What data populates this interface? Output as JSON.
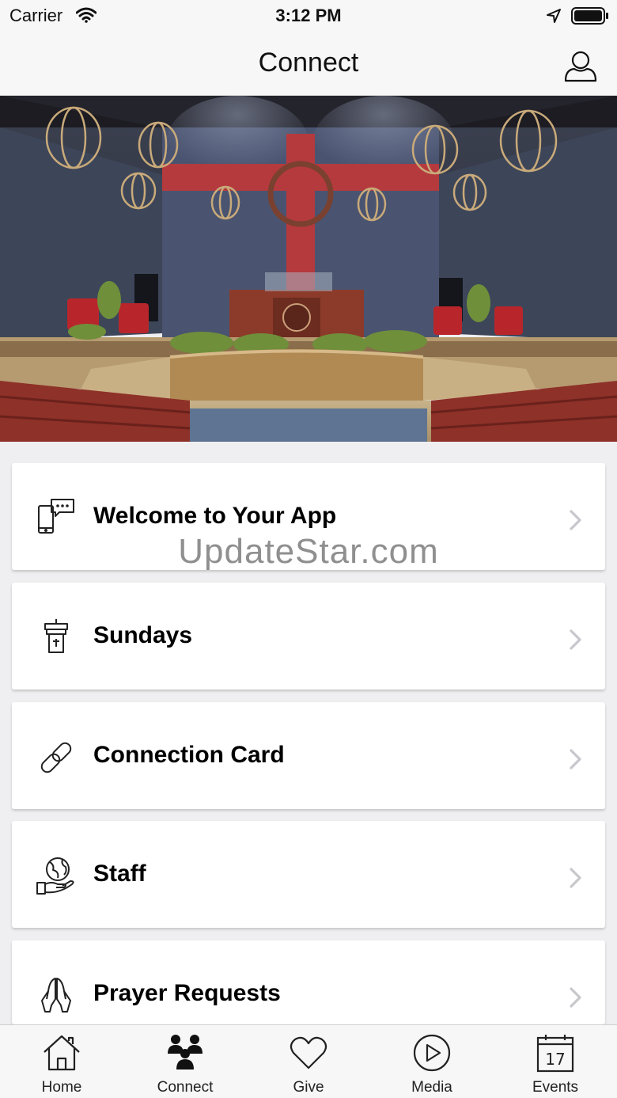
{
  "status_bar": {
    "carrier": "Carrier",
    "time": "3:12 PM"
  },
  "nav": {
    "title": "Connect",
    "profile_icon": "person-icon"
  },
  "hero": {
    "description_icon": "sanctuary-photo"
  },
  "menu": [
    {
      "label": "Welcome to Your App",
      "icon": "phone-chat-icon"
    },
    {
      "label": "Sundays",
      "icon": "pulpit-icon"
    },
    {
      "label": "Connection Card",
      "icon": "link-icon"
    },
    {
      "label": "Staff",
      "icon": "globe-hand-icon"
    },
    {
      "label": "Prayer Requests",
      "icon": "praying-hands-icon"
    }
  ],
  "watermark": "UpdateStar.com",
  "tabs": [
    {
      "label": "Home",
      "icon": "house-icon"
    },
    {
      "label": "Connect",
      "icon": "people-icon",
      "active": true
    },
    {
      "label": "Give",
      "icon": "heart-icon"
    },
    {
      "label": "Media",
      "icon": "play-icon"
    },
    {
      "label": "Events",
      "icon": "calendar-icon",
      "calendar_day": "17"
    }
  ],
  "colors": {
    "accent": "#000000",
    "background": "#efeff1",
    "card": "#ffffff",
    "chevron": "#c7c7cc"
  }
}
